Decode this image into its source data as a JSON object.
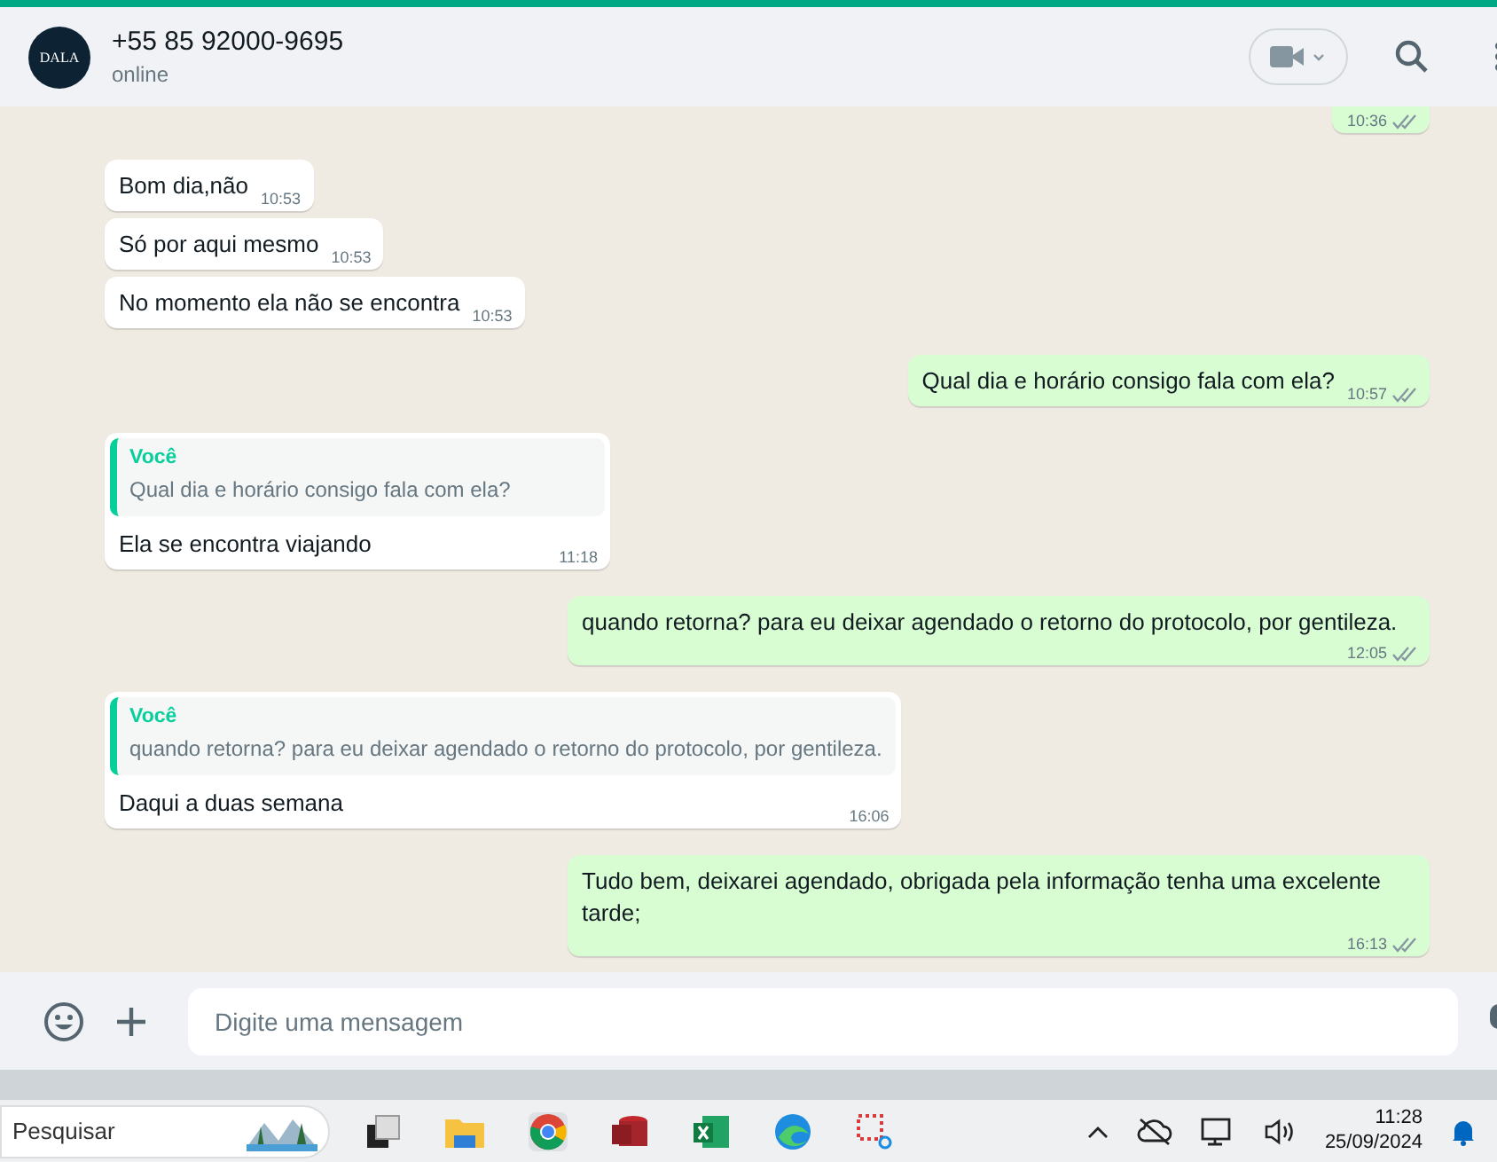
{
  "header": {
    "avatar_text": "DALA",
    "name": "+55 85 92000-9695",
    "status": "online"
  },
  "messages": [
    {
      "kind": "out",
      "time": "10:36"
    },
    {
      "kind": "in",
      "text": "Bom dia,não",
      "time": "10:53"
    },
    {
      "kind": "in",
      "text": "Só por aqui mesmo",
      "time": "10:53"
    },
    {
      "kind": "in",
      "text": "No momento ela não se encontra",
      "time": "10:53"
    },
    {
      "kind": "out",
      "text": "Qual dia e horário consigo fala com ela?",
      "time": "10:57"
    },
    {
      "kind": "in",
      "quote": {
        "author": "Você",
        "text": "Qual dia e horário consigo fala com ela?"
      },
      "text": "Ela se encontra viajando",
      "time": "11:18"
    },
    {
      "kind": "out",
      "text": "quando retorna? para eu deixar agendado o retorno do protocolo, por gentileza.",
      "time": "12:05"
    },
    {
      "kind": "in",
      "quote": {
        "author": "Você",
        "text": "quando retorna? para eu deixar agendado o retorno do protocolo, por gentileza."
      },
      "text": "Daqui a duas semana",
      "time": "16:06"
    },
    {
      "kind": "out",
      "text": "Tudo bem, deixarei agendado, obrigada pela informação tenha uma excelente tarde;",
      "time": "16:13"
    }
  ],
  "composer": {
    "placeholder": "Digite uma mensagem"
  },
  "taskbar": {
    "search": {
      "placeholder": "Pesquisar"
    },
    "time": "11:28",
    "date": "25/09/2024"
  }
}
